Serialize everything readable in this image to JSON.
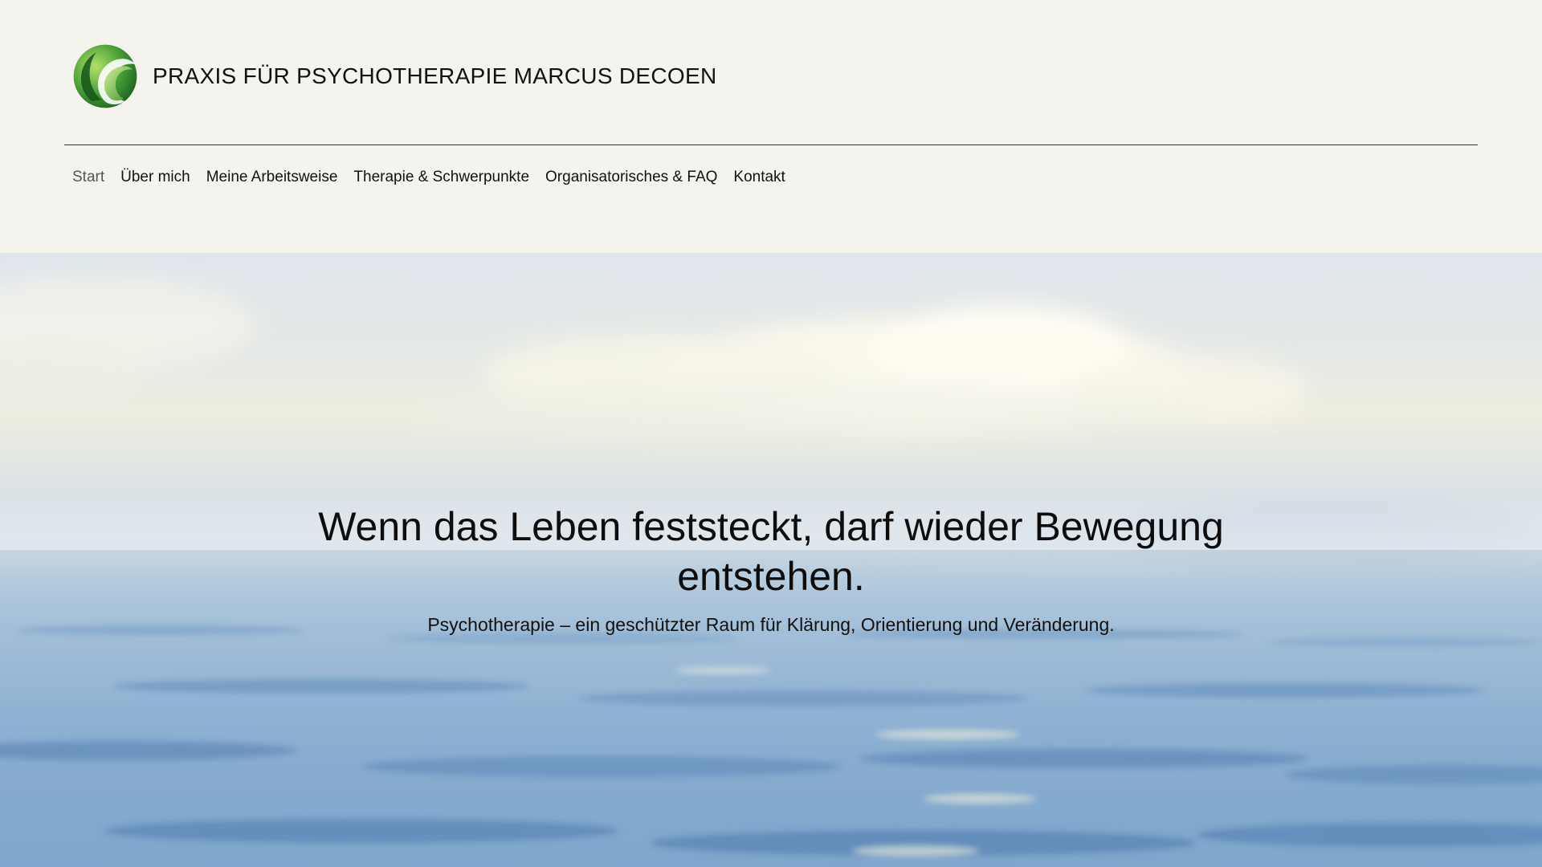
{
  "site": {
    "title": "PRAXIS FÜR PSYCHOTHERAPIE MARCUS DECOEN",
    "logo_icon": "green-leaf-circle-logo-icon",
    "accent_color": "#2f8f2f"
  },
  "nav": {
    "items": [
      {
        "label": "Start",
        "active": true
      },
      {
        "label": "Über mich",
        "active": false
      },
      {
        "label": "Meine Arbeitsweise",
        "active": false
      },
      {
        "label": "Therapie & Schwerpunkte",
        "active": false
      },
      {
        "label": "Organisatorisches & FAQ",
        "active": false
      },
      {
        "label": "Kontakt",
        "active": false
      }
    ]
  },
  "hero": {
    "heading": "Wenn das Leben feststeckt, darf wieder Bewegung entstehen.",
    "subheading": "Psychotherapie – ein geschützter Raum für Klärung, Orientierung und Veränderung.",
    "background": "sky-and-sea-photo"
  }
}
